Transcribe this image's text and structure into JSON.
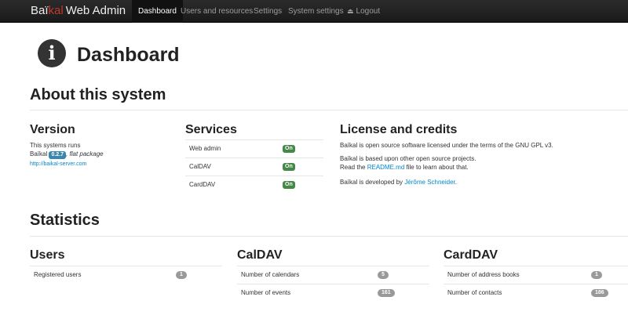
{
  "navbar": {
    "brand_part1": "Baï",
    "brand_part2": "kal",
    "brand_part3": "Web Admin",
    "items": [
      {
        "label": "Dashboard"
      },
      {
        "label": "Users and resources"
      },
      {
        "label": "Settings"
      },
      {
        "label": "System settings"
      },
      {
        "label": "Logout"
      }
    ],
    "logout_icon": "eject-icon"
  },
  "header": {
    "icon": "info-icon",
    "title": "Dashboard"
  },
  "about": {
    "title": "About this system",
    "version": {
      "title": "Version",
      "line1": "This systems runs",
      "line2_prefix": "Baïkal",
      "version_number": "0.2.7",
      "line2_suffix": ", flat package",
      "link": "http://baikal-server.com"
    },
    "services": {
      "title": "Services",
      "rows": [
        {
          "label": "Web admin",
          "status": "On"
        },
        {
          "label": "CalDAV",
          "status": "On"
        },
        {
          "label": "CardDAV",
          "status": "On"
        }
      ]
    },
    "license": {
      "title": "License and credits",
      "line1": "Baïkal is open source software licensed under the terms of the GNU GPL v3.",
      "line2": "Baïkal is based upon other open source projects.",
      "line3_prefix": "Read the",
      "line3_link": "README.md",
      "line3_suffix": "file to learn about that.",
      "line4_prefix": "Baïkal is developed by",
      "line4_link": "Jérôme Schneider",
      "line4_suffix": "."
    }
  },
  "statistics": {
    "title": "Statistics",
    "users": {
      "title": "Users",
      "rows": [
        {
          "label": "Registered users",
          "count": "1"
        }
      ]
    },
    "caldav": {
      "title": "CalDAV",
      "rows": [
        {
          "label": "Number of calendars",
          "count": "5"
        },
        {
          "label": "Number of events",
          "count": "161"
        }
      ]
    },
    "carddav": {
      "title": "CardDAV",
      "rows": [
        {
          "label": "Number of address books",
          "count": "1"
        },
        {
          "label": "Number of contacts",
          "count": "186"
        }
      ]
    }
  },
  "colors": {
    "navbar_bg": "#1a1a1a",
    "on_badge": "#468847",
    "version_badge": "#3a87ad",
    "count_badge": "#999999",
    "link": "#0088cc"
  }
}
